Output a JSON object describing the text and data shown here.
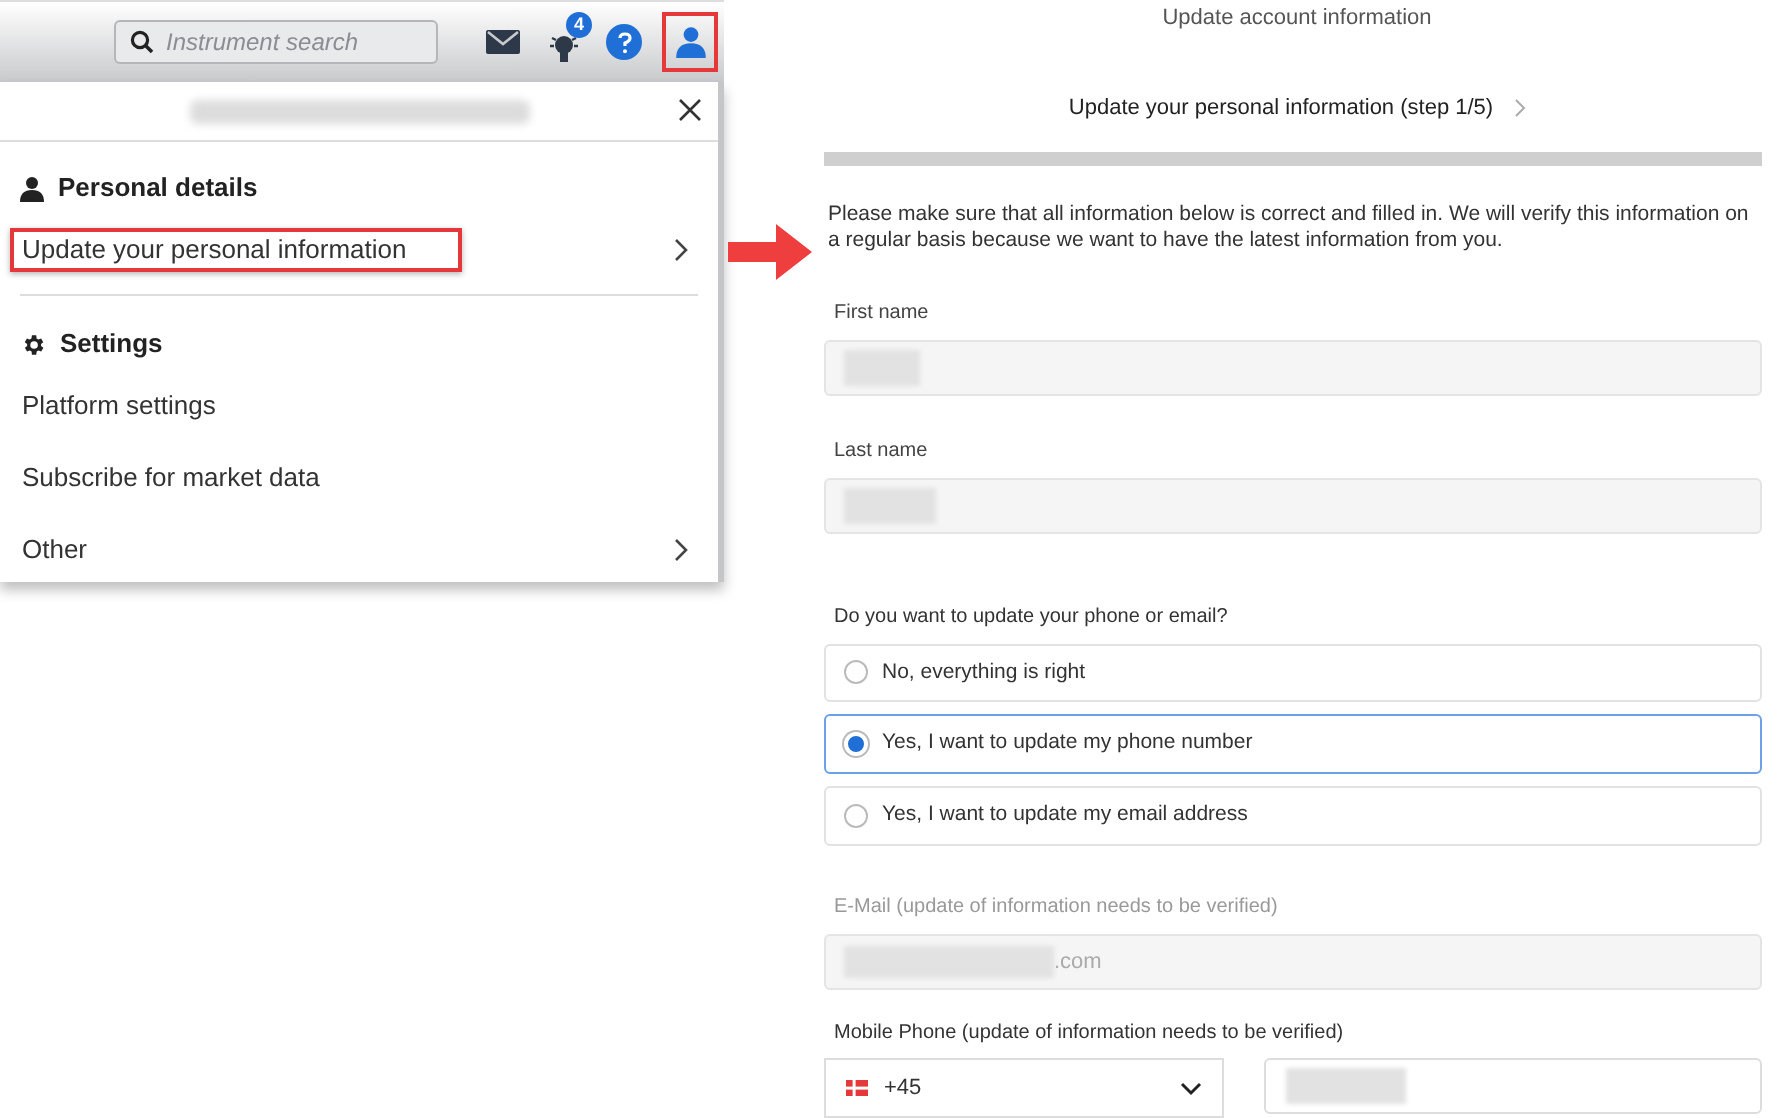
{
  "toolbar": {
    "search_placeholder": "Instrument search",
    "notification_count": "4",
    "profile_highlighted": true
  },
  "menu": {
    "sections": [
      {
        "title": "Personal details",
        "items": [
          {
            "label": "Update your personal information",
            "has_arrow": true,
            "highlighted": true
          }
        ]
      },
      {
        "title": "Settings",
        "items": [
          {
            "label": "Platform settings",
            "has_arrow": false,
            "highlighted": false
          },
          {
            "label": "Subscribe for market data",
            "has_arrow": false,
            "highlighted": false
          },
          {
            "label": "Other",
            "has_arrow": true,
            "highlighted": false
          }
        ]
      }
    ]
  },
  "form": {
    "title": "Update account information",
    "step": "Update your personal information (step 1/5)",
    "intro": "Please make sure that all information below is correct and filled in. We will verify this information on a regular basis because we want to have the latest information from you.",
    "progress": {
      "level": 0
    },
    "fields": [
      {
        "label": "First name"
      },
      {
        "label": "Last name"
      }
    ],
    "question": "Do you want to update your phone or email?",
    "options": [
      {
        "label": "No, everything is right",
        "selected": false
      },
      {
        "label": "Yes, I want to update my phone number",
        "selected": true
      },
      {
        "label": "Yes, I want to update my email address",
        "selected": false
      }
    ],
    "email": {
      "label": "E-Mail (update of information needs to be verified)",
      "value": ".com"
    },
    "phone": {
      "label": "Mobile Phone (update of information needs to be verified)",
      "country_code": "+45"
    }
  }
}
